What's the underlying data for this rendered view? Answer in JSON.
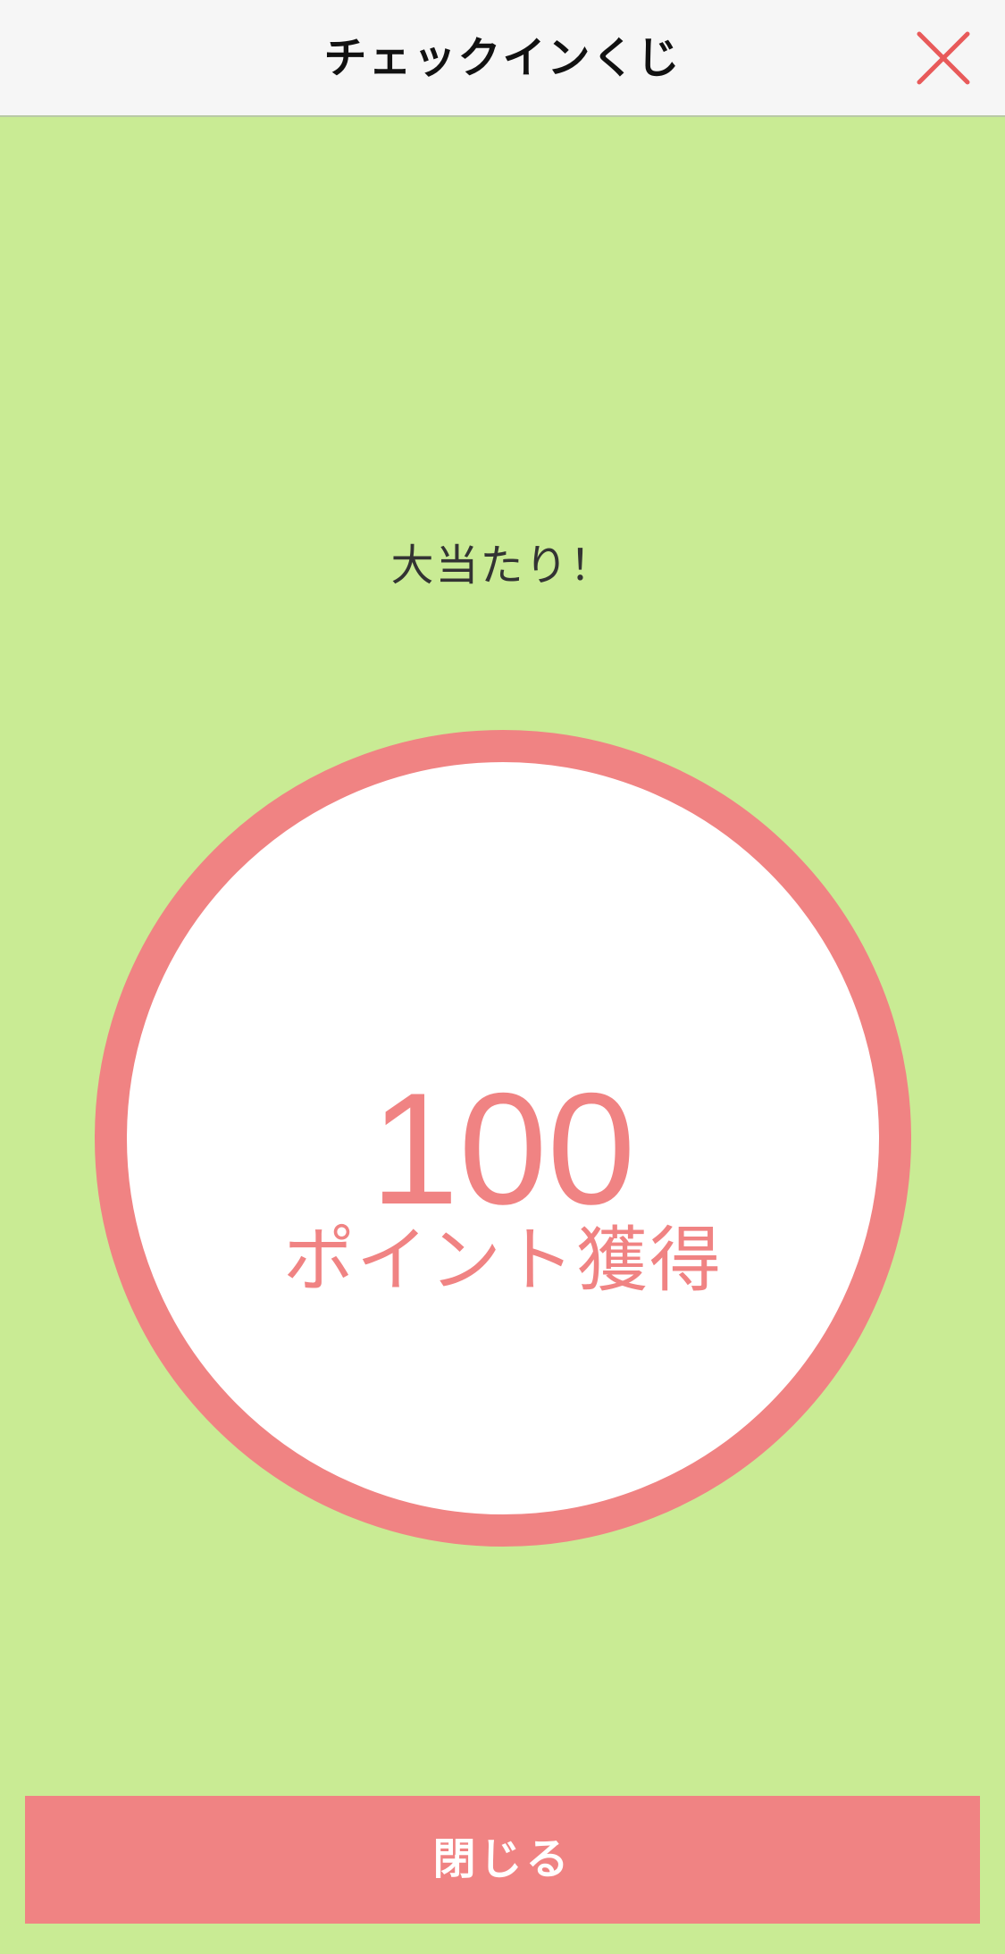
{
  "header": {
    "title": "チェックインくじ",
    "close_icon": "close-icon"
  },
  "result": {
    "label": "大当たり！",
    "points": "100",
    "points_label": "ポイント獲得"
  },
  "footer": {
    "close_label": "閉じる"
  },
  "colors": {
    "background": "#c9eb94",
    "accent": "#f08383",
    "header_bg": "#f6f6f6",
    "close_icon": "#e85a5a"
  }
}
